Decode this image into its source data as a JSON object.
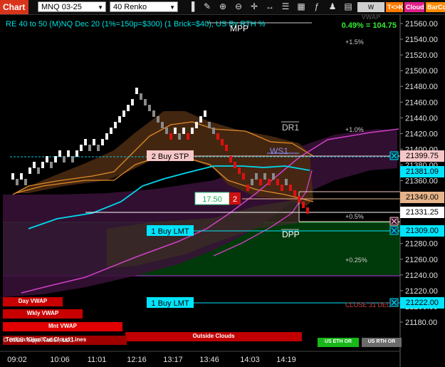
{
  "toolbar": {
    "chart_label": "Chart",
    "instrument": "MNQ 03-25",
    "bar_type": "40 Renko",
    "wvwap_label": "W VWAP",
    "tk_label": "T<>K",
    "cloud_label": "Cloud",
    "barcol_label": "BarCo",
    "icons": [
      "chart-bars-icon",
      "draw-icon",
      "zoom-in-icon",
      "zoom-out-icon",
      "crosshair-icon",
      "scroll-icon",
      "properties-icon",
      "data-box-icon",
      "indicators-icon",
      "strategy-icon",
      "templates-icon"
    ]
  },
  "header": {
    "info": "RE 40 to 50 (M)NQ Dec 20 (1%=150p=$300) (1 Brick=$40), US By RTH %",
    "percent": "0.49% = 104.75"
  },
  "levels": {
    "mpp": "MPP",
    "dr1": "DR1",
    "ws1": "WS1",
    "dpp": "DPP",
    "pct_1_5": "+1.5%",
    "pct_1_0": "+1.0%",
    "pct_0_5": "+0.5%",
    "pct_0_25": "+0.25%",
    "close_31": "CLOSE 31 DEC"
  },
  "orders": {
    "buy_stp": "2 Buy STP",
    "buy_lmt_1": "1 Buy LMT",
    "buy_lmt_2": "1 Buy LMT",
    "position_price": "17.50",
    "position_qty": "2"
  },
  "price_axis": {
    "ticks": [
      "21560.00",
      "21540.00",
      "21520.00",
      "21500.00",
      "21480.00",
      "21460.00",
      "21440.00",
      "21420.00",
      "21400.00",
      "21380.00",
      "21360.00",
      "21340.00",
      "21320.00",
      "21300.00",
      "21280.00",
      "21260.00",
      "21240.00",
      "21220.00",
      "21200.00",
      "21180.00"
    ],
    "boxes": [
      {
        "label": "21399.75",
        "bg": "#f6c7c8",
        "fg": "#000000"
      },
      {
        "label": "21381.09",
        "bg": "#00e5ff",
        "fg": "#000000"
      },
      {
        "label": "21349.00",
        "bg": "#e6b48a",
        "fg": "#000000"
      },
      {
        "label": "21331.25",
        "bg": "#ffffff",
        "fg": "#000000"
      },
      {
        "label": "21309.00",
        "bg": "#00e5ff",
        "fg": "#000000"
      },
      {
        "label": "21222.00",
        "bg": "#00e5ff",
        "fg": "#000000"
      }
    ]
  },
  "time_axis": [
    "09:02",
    "10:06",
    "11:01",
    "12:16",
    "13:17",
    "13:46",
    "14:03",
    "14:19"
  ],
  "bottom_bars": {
    "day_vwap": "Day VWAP",
    "wkly_vwap": "Wkly VWAP",
    "mnt_vwap": "Mnt VWAP",
    "outside_clouds": "Outside Clouds",
    "copyright": "© 2025 NinjaTrader, LLC",
    "tenkan": "Tenkan Kijun Cut Cloud Lines",
    "us_eth": "US ETH OR",
    "us_rth": "US RTH OR"
  },
  "colors": {
    "accent_red": "#d8341c",
    "cyan": "#00e5ff",
    "vwap_band": "#3a1238",
    "green_zone": "#003a0a",
    "brown_cloud": "#4a2a12"
  }
}
